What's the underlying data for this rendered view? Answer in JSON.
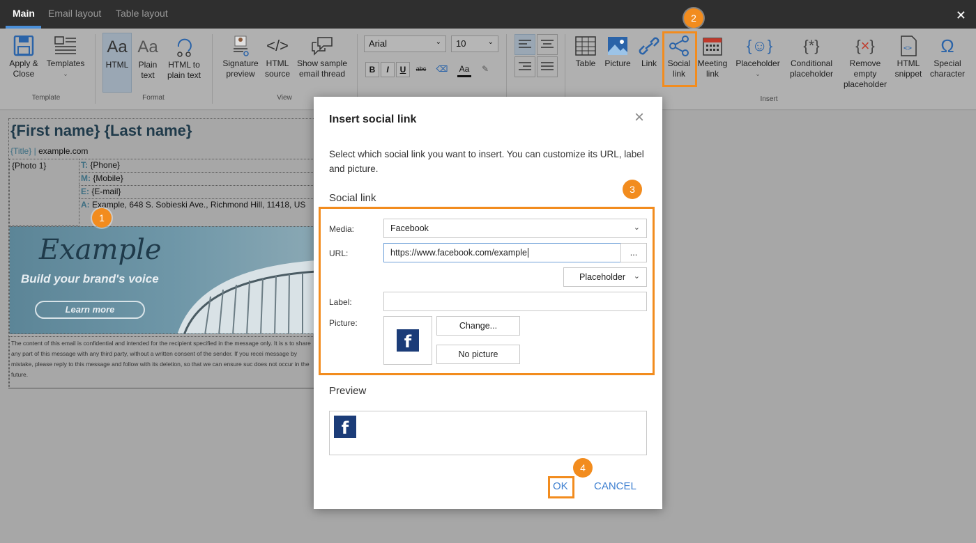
{
  "tabs": [
    {
      "label": "Main",
      "active": true
    },
    {
      "label": "Email layout",
      "active": false
    },
    {
      "label": "Table layout",
      "active": false
    }
  ],
  "ribbon": {
    "template": {
      "apply_close": "Apply &\nClose",
      "templates": "Templates",
      "group": "Template"
    },
    "format": {
      "html": "HTML",
      "plain_text": "Plain\ntext",
      "html_to_plain": "HTML to\nplain text",
      "group": "Format"
    },
    "view": {
      "signature_preview": "Signature\npreview",
      "html_source": "HTML\nsource",
      "show_sample": "Show sample\nemail thread",
      "group": "View"
    },
    "font": {
      "family": "Arial",
      "size": "10"
    },
    "insert": {
      "table": "Table",
      "picture": "Picture",
      "link": "Link",
      "social_link": "Social\nlink",
      "meeting_link": "Meeting\nlink",
      "placeholder": "Placeholder",
      "conditional_placeholder": "Conditional\nplaceholder",
      "remove_empty_placeholder": "Remove\nempty\nplaceholder",
      "html_snippet": "HTML\nsnippet",
      "special_character": "Special\ncharacter",
      "group": "Insert"
    }
  },
  "signature": {
    "name": "{First name} {Last name}",
    "title": "{Title}",
    "separator": "|",
    "website": "example.com",
    "photo": "{Photo 1}",
    "lines": [
      {
        "key": "T:",
        "value": "{Phone}"
      },
      {
        "key": "M:",
        "value": "{Mobile}"
      },
      {
        "key": "E:",
        "value": "{E-mail}"
      },
      {
        "key": "A:",
        "value": "Example, 648 S. Sobieski Ave., Richmond Hill, 11418, US"
      }
    ],
    "banner": {
      "title": "Example",
      "subtitle": "Build your brand's voice",
      "button": "Learn more"
    },
    "disclaimer": "The content of this email is confidential and intended for the recipient specified in the message only. It is s to share any part of this message with any third party, without a written consent of the sender. If you recei message by mistake, please reply to this message and follow with its deletion, so that we can ensure suc does not occur in the future."
  },
  "dialog": {
    "title": "Insert social link",
    "close": "×",
    "intro": "Select which social link you want to insert. You can customize its URL, label and picture.",
    "section_social": "Social link",
    "media_label": "Media:",
    "media_value": "Facebook",
    "url_label": "URL:",
    "url_value": "https://www.facebook.com/example",
    "browse": "...",
    "placeholder_btn": "Placeholder",
    "label_label": "Label:",
    "label_value": "",
    "picture_label": "Picture:",
    "change_btn": "Change...",
    "no_picture_btn": "No picture",
    "preview_section": "Preview",
    "fb_glyph": "f",
    "ok": "OK",
    "cancel": "CANCEL"
  },
  "callouts": [
    "1",
    "2",
    "3",
    "4"
  ],
  "colors": {
    "accent": "#f28c1e",
    "link": "#3d7fd0",
    "facebook": "#1b3c78",
    "ribbon": "#b0b0b0",
    "topbar": "#2f2f2f"
  }
}
